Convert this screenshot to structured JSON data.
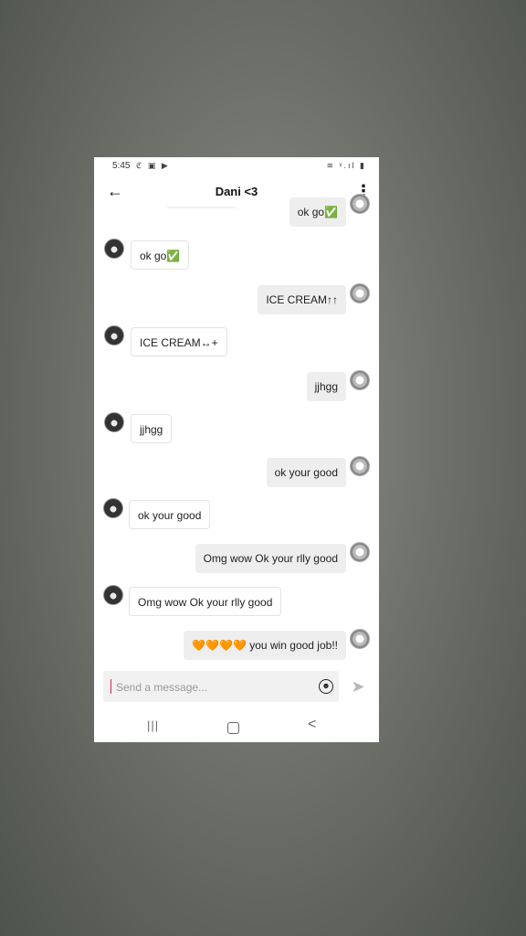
{
  "status_bar": {
    "time": "5:45",
    "left_icons": "ℭ ▣ ▶",
    "right_icons": "≋ ᵛ.ıl ▮"
  },
  "header": {
    "title": "Dani <3",
    "back_icon": "←",
    "more_icon": "⋮"
  },
  "messages": [
    {
      "side": "out",
      "text": "ok go✅"
    },
    {
      "side": "in",
      "text": "ok go✅"
    },
    {
      "side": "out",
      "text": "ICE CREAM↑↑"
    },
    {
      "side": "in",
      "text": "ICE CREAM↔+"
    },
    {
      "side": "out",
      "text": "jjhgg"
    },
    {
      "side": "in",
      "text": "jjhgg"
    },
    {
      "side": "out",
      "text": "ok your good"
    },
    {
      "side": "in",
      "text": "ok your good"
    },
    {
      "side": "out",
      "text": "Omg wow Ok your rlly good"
    },
    {
      "side": "in",
      "text": "Omg wow Ok your rlly good"
    },
    {
      "side": "out",
      "text": "🧡🧡🧡🧡 you win good job!!"
    }
  ],
  "composer": {
    "placeholder": "Send a message...",
    "emoji_icon": "☻",
    "send_icon": "➤"
  },
  "nav_bar": {
    "recent_icon": "|||",
    "home_icon": "home-square",
    "back_icon": "<"
  },
  "colors": {
    "accent_cursor": "#e0244a",
    "bubble_out": "#eeeeee",
    "bubble_in": "#ffffff"
  }
}
